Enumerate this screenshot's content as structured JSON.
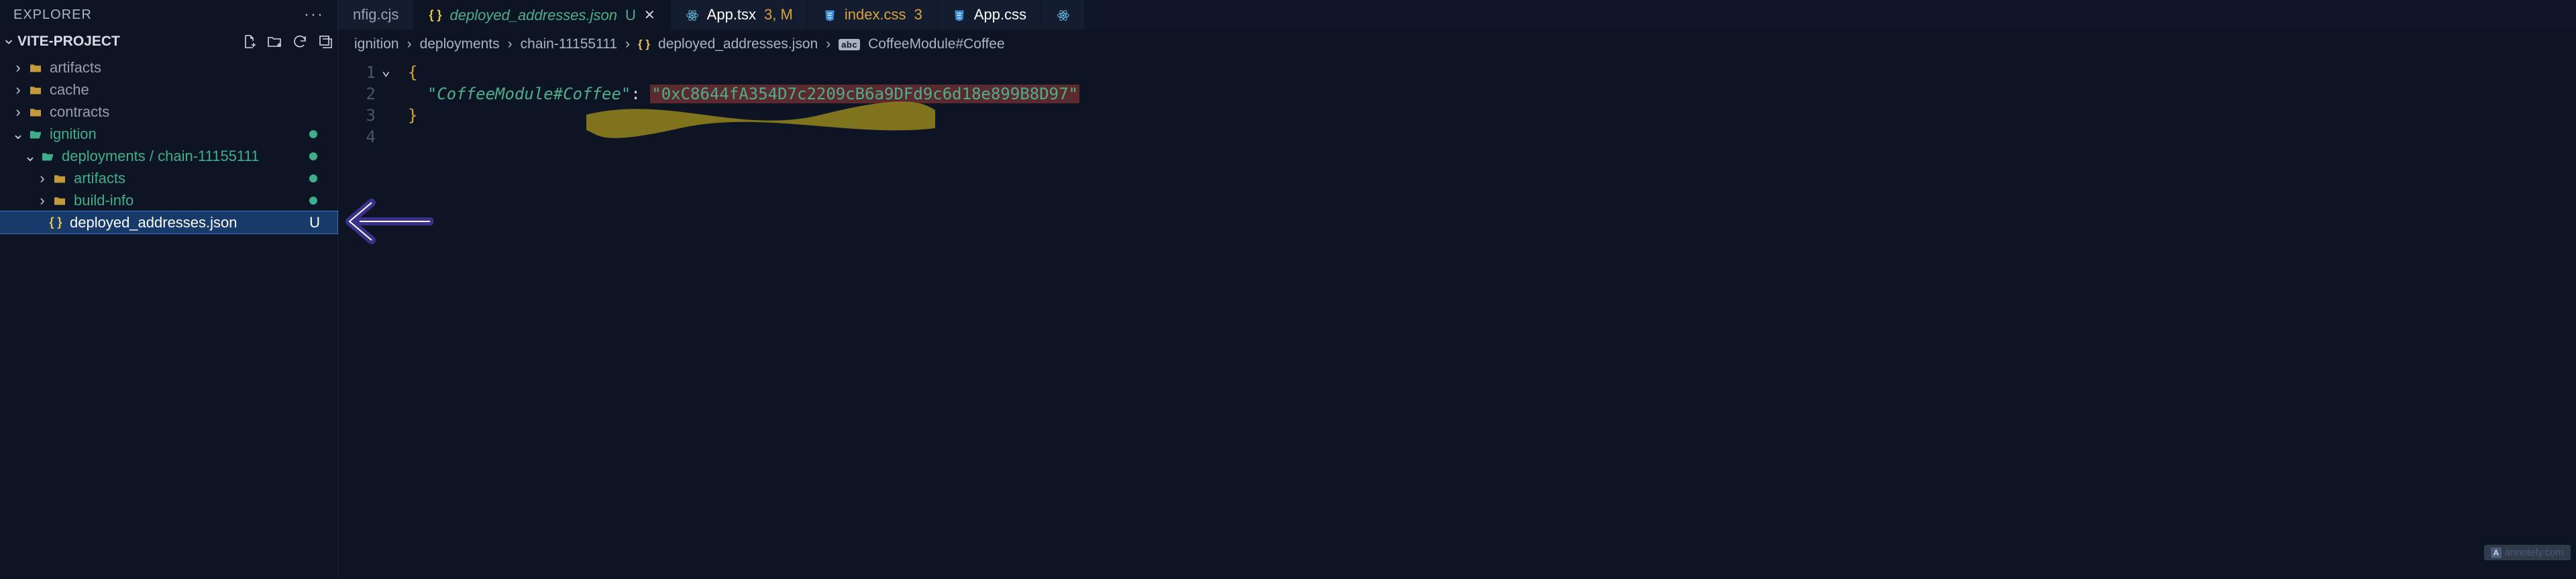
{
  "explorer": {
    "title": "EXPLORER",
    "project": "VITE-PROJECT",
    "tree": {
      "artifacts": "artifacts",
      "cache": "cache",
      "contracts": "contracts",
      "ignition": "ignition",
      "deployments": "deployments",
      "chain": "chain-11155111",
      "artifacts2": "artifacts",
      "buildinfo": "build-info",
      "deployed": "deployed_addresses.json",
      "deployed_badge": "U"
    }
  },
  "tabs": {
    "cfg": "nfig.cjs",
    "deployed": "deployed_addresses.json",
    "deployed_u": "U",
    "apptsx": "App.tsx",
    "apptsx_badge": "3, M",
    "indexcss": "index.css",
    "indexcss_badge": "3",
    "appcss": "App.css"
  },
  "breadcrumb": {
    "c1": "ignition",
    "c2": "deployments",
    "c3": "chain-11155111",
    "c4": "deployed_addresses.json",
    "c5": "CoffeeModule#Coffee"
  },
  "editor": {
    "ln1": "1",
    "ln2": "2",
    "ln3": "3",
    "ln4": "4",
    "open": "{",
    "key": "\"CoffeeModule#Coffee\"",
    "colon": ": ",
    "val": "\"0xC8644fA354D7c2209cB6a9DFd9c6d18e899B8D97\"",
    "close": "}"
  },
  "badge": "annotely.com"
}
